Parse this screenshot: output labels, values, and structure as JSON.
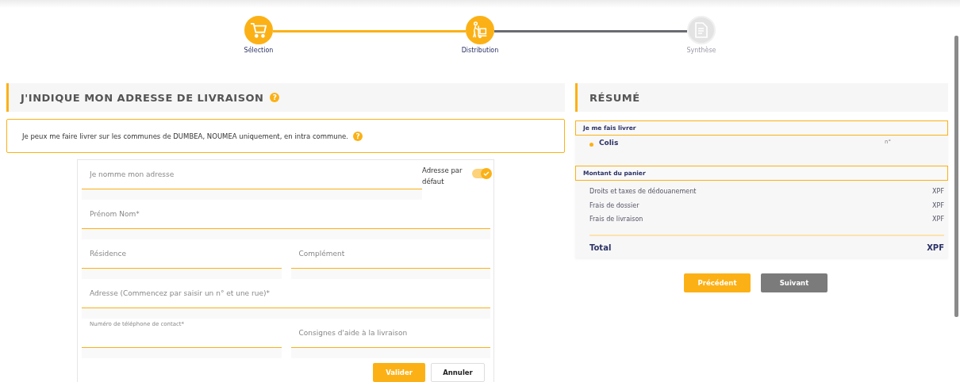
{
  "steps": [
    {
      "label": "Sélection",
      "reached": true
    },
    {
      "label": "Distribution",
      "reached": true
    },
    {
      "label": "Synthèse",
      "reached": false
    }
  ],
  "address": {
    "title": "J'INDIQUE MON ADRESSE DE LIVRAISON",
    "title_help": "?",
    "notice": "Je peux me faire livrer sur les communes de DUMBEA, NOUMEA uniquement, en intra commune.",
    "notice_help": "?",
    "name_field": {
      "placeholder": "Je nomme mon adresse"
    },
    "default_toggle": {
      "label": "Adresse par défaut",
      "on": true
    },
    "rows": [
      [
        {
          "placeholder": "Prénom Nom*"
        }
      ],
      [
        {
          "placeholder": "Résidence"
        },
        {
          "placeholder": "Complément"
        }
      ],
      [
        {
          "placeholder": "Adresse (Commencez par saisir un n° et une rue)*"
        }
      ],
      [
        {
          "label": "Numéro de téléphone de contact*"
        },
        {
          "placeholder": "Consignes d'aide à la livraison"
        }
      ]
    ],
    "buttons": [
      {
        "label": "Valider",
        "kind": "primary"
      },
      {
        "label": "Annuler",
        "kind": "secondary"
      }
    ]
  },
  "summary": {
    "title": "RÉSUMÉ",
    "delivery": {
      "heading": "Je me fais livrer",
      "item": "Colis",
      "number_label": "n°"
    },
    "amount": {
      "heading": "Montant du panier",
      "lines": [
        {
          "label": "Droits et taxes de dédouanement",
          "currency": "XPF"
        },
        {
          "label": "Frais de dossier",
          "currency": "XPF"
        },
        {
          "label": "Frais de livraison",
          "currency": "XPF"
        }
      ],
      "total": {
        "label": "Total",
        "currency": "XPF"
      }
    }
  },
  "nav_buttons": [
    {
      "label": "Précédent",
      "kind": "primary"
    },
    {
      "label": "Suivant",
      "kind": "muted"
    }
  ]
}
